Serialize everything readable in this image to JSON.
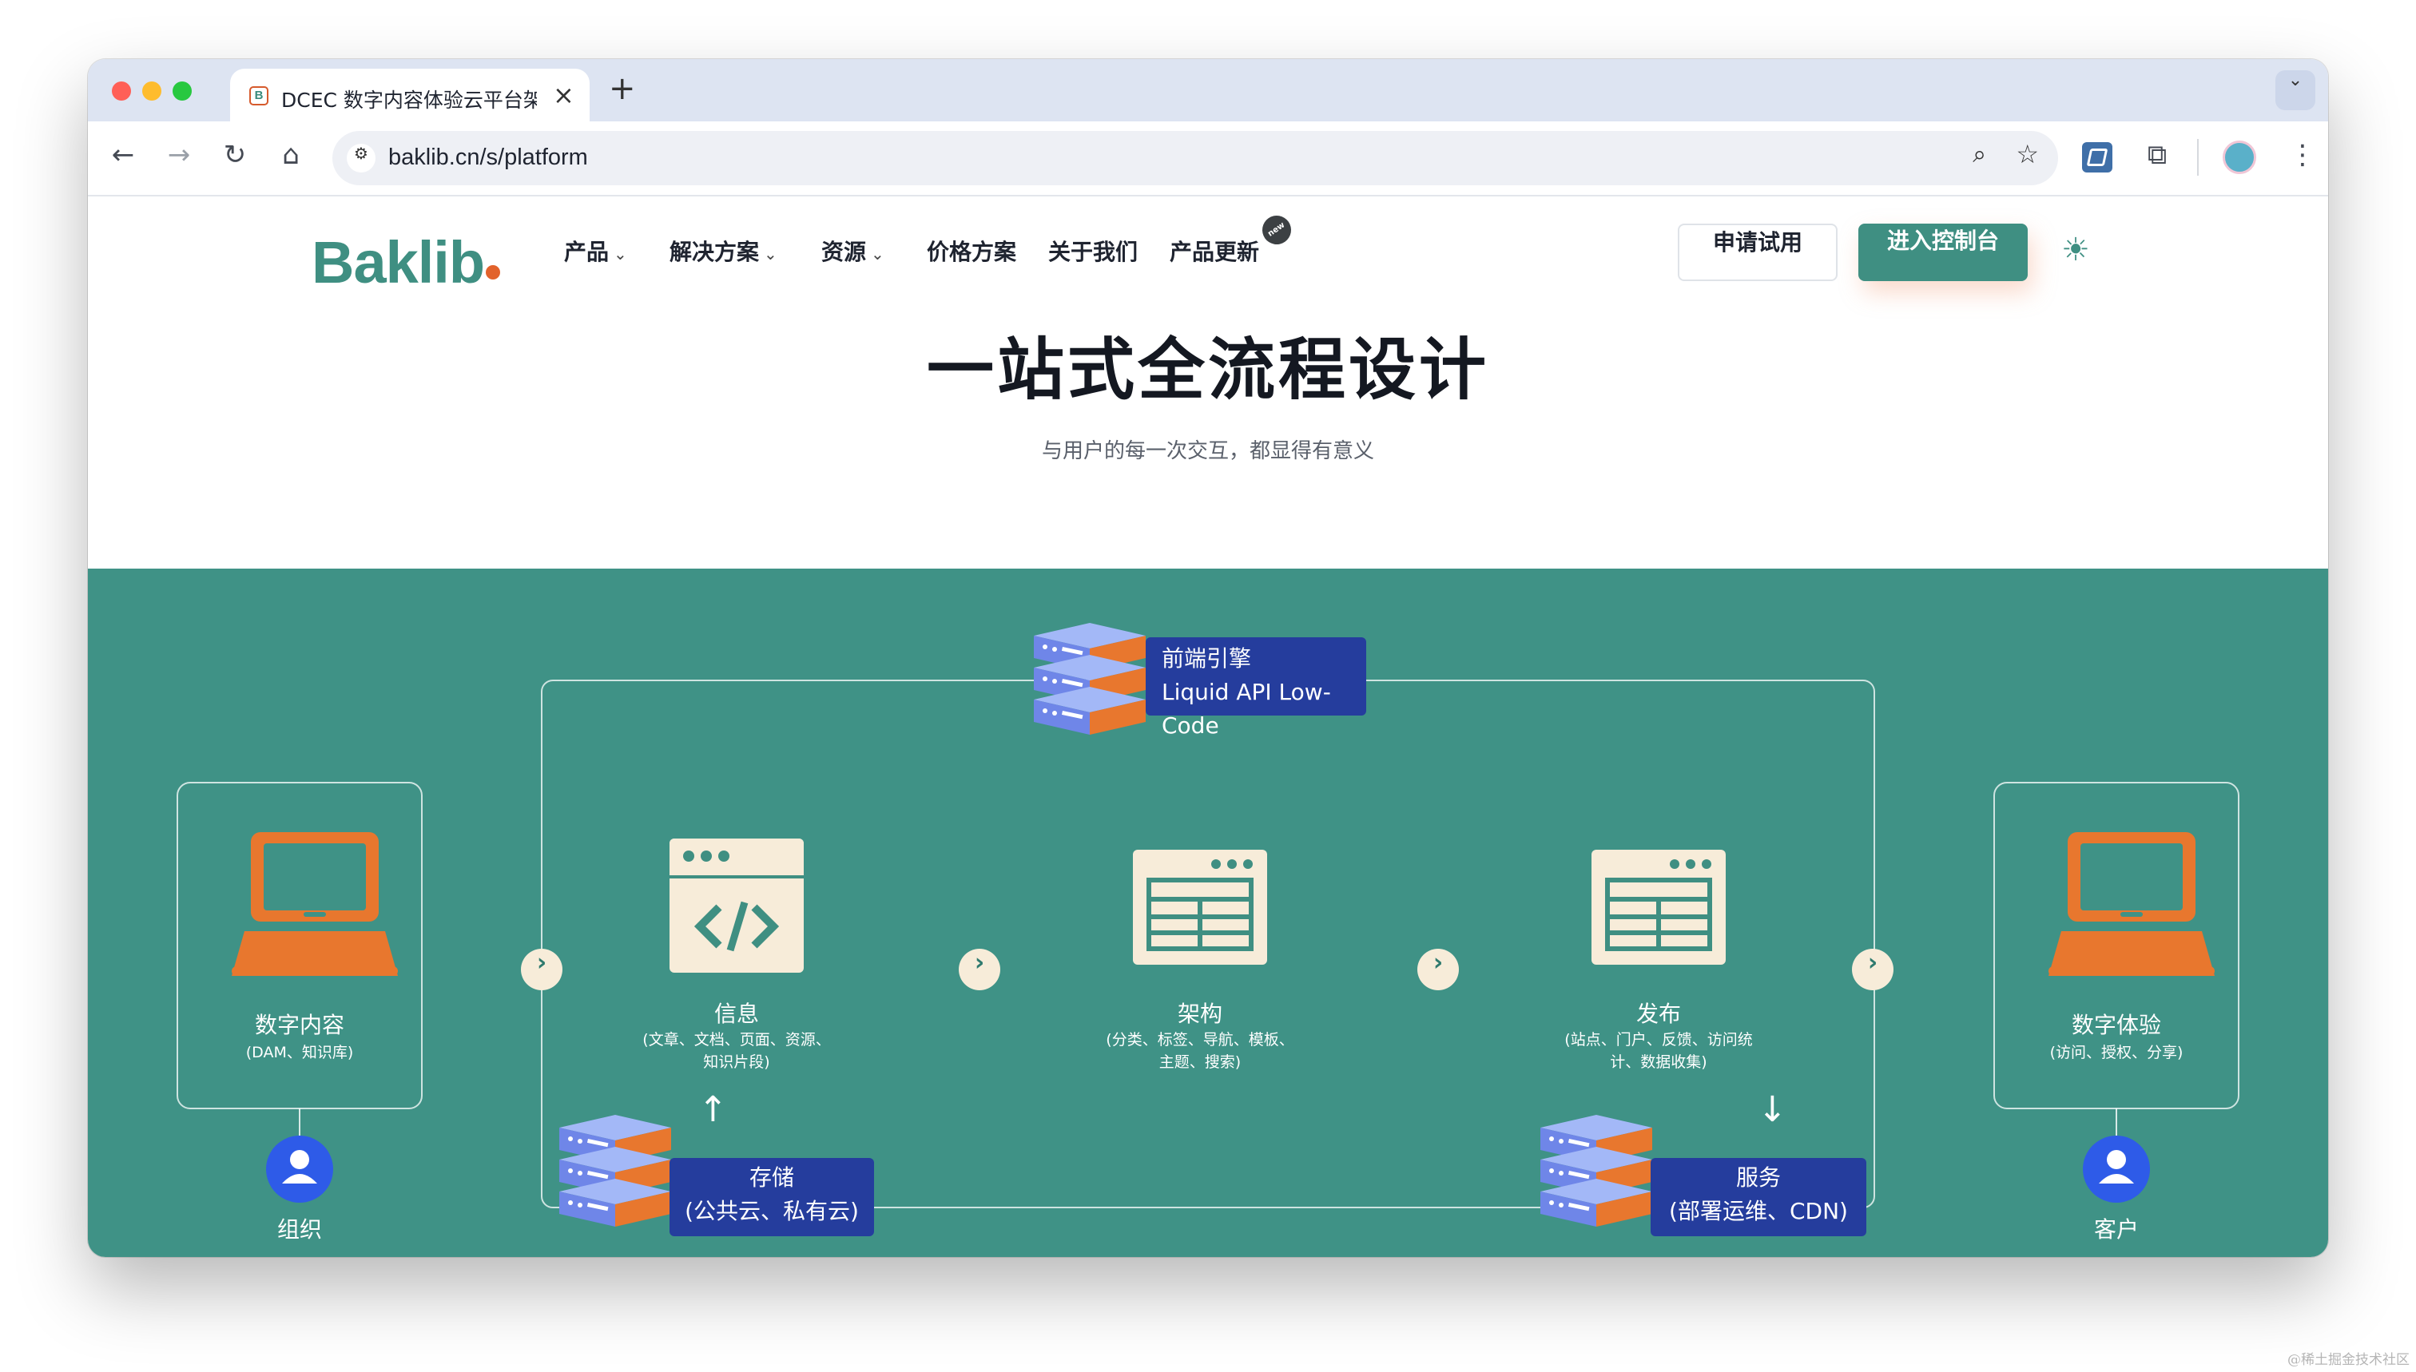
{
  "browser": {
    "tab_title": "DCEC 数字内容体验云平台架构",
    "tab_favicon": "B",
    "url": "baklib.cn/s/platform",
    "traffic_lights": [
      "#ff5f57",
      "#febc2e",
      "#28c840"
    ]
  },
  "site": {
    "logo": "Baklib",
    "nav": [
      {
        "label": "产品",
        "dropdown": true
      },
      {
        "label": "解决方案",
        "dropdown": true
      },
      {
        "label": "资源",
        "dropdown": true
      },
      {
        "label": "价格方案",
        "dropdown": false
      },
      {
        "label": "关于我们",
        "dropdown": false
      },
      {
        "label": "产品更新",
        "dropdown": false
      }
    ],
    "new_badge": "new",
    "trial_button": "申请试用",
    "console_button": "进入控制台",
    "accent": "#3f8f82",
    "brand_dot": "#e2622b"
  },
  "hero": {
    "title": "一站式全流程设计",
    "subtitle": "与用户的每一次交互，都显得有意义"
  },
  "diagram": {
    "background": "#3f9286",
    "frontend_engine": {
      "line1": "前端引擎",
      "line2": "Liquid API Low-Code"
    },
    "left_panel": {
      "label": "数字内容",
      "sub": "(DAM、知识库)"
    },
    "right_panel": {
      "label": "数字体验",
      "sub": "(访问、授权、分享)"
    },
    "steps": [
      {
        "label": "信息",
        "sub1": "(文章、文档、页面、资源、",
        "sub2": "知识片段)"
      },
      {
        "label": "架构",
        "sub1": "(分类、标签、导航、模板、",
        "sub2": "主题、搜索)"
      },
      {
        "label": "发布",
        "sub1": "(站点、门户、反馈、访问统",
        "sub2": "计、数据收集)"
      }
    ],
    "storage": {
      "line1": "存储",
      "line2": "(公共云、私有云)"
    },
    "service": {
      "line1": "服务",
      "line2": "(部署运维、CDN)"
    },
    "org_label": "组织",
    "customer_label": "客户"
  },
  "watermark": "@稀土掘金技术社区"
}
